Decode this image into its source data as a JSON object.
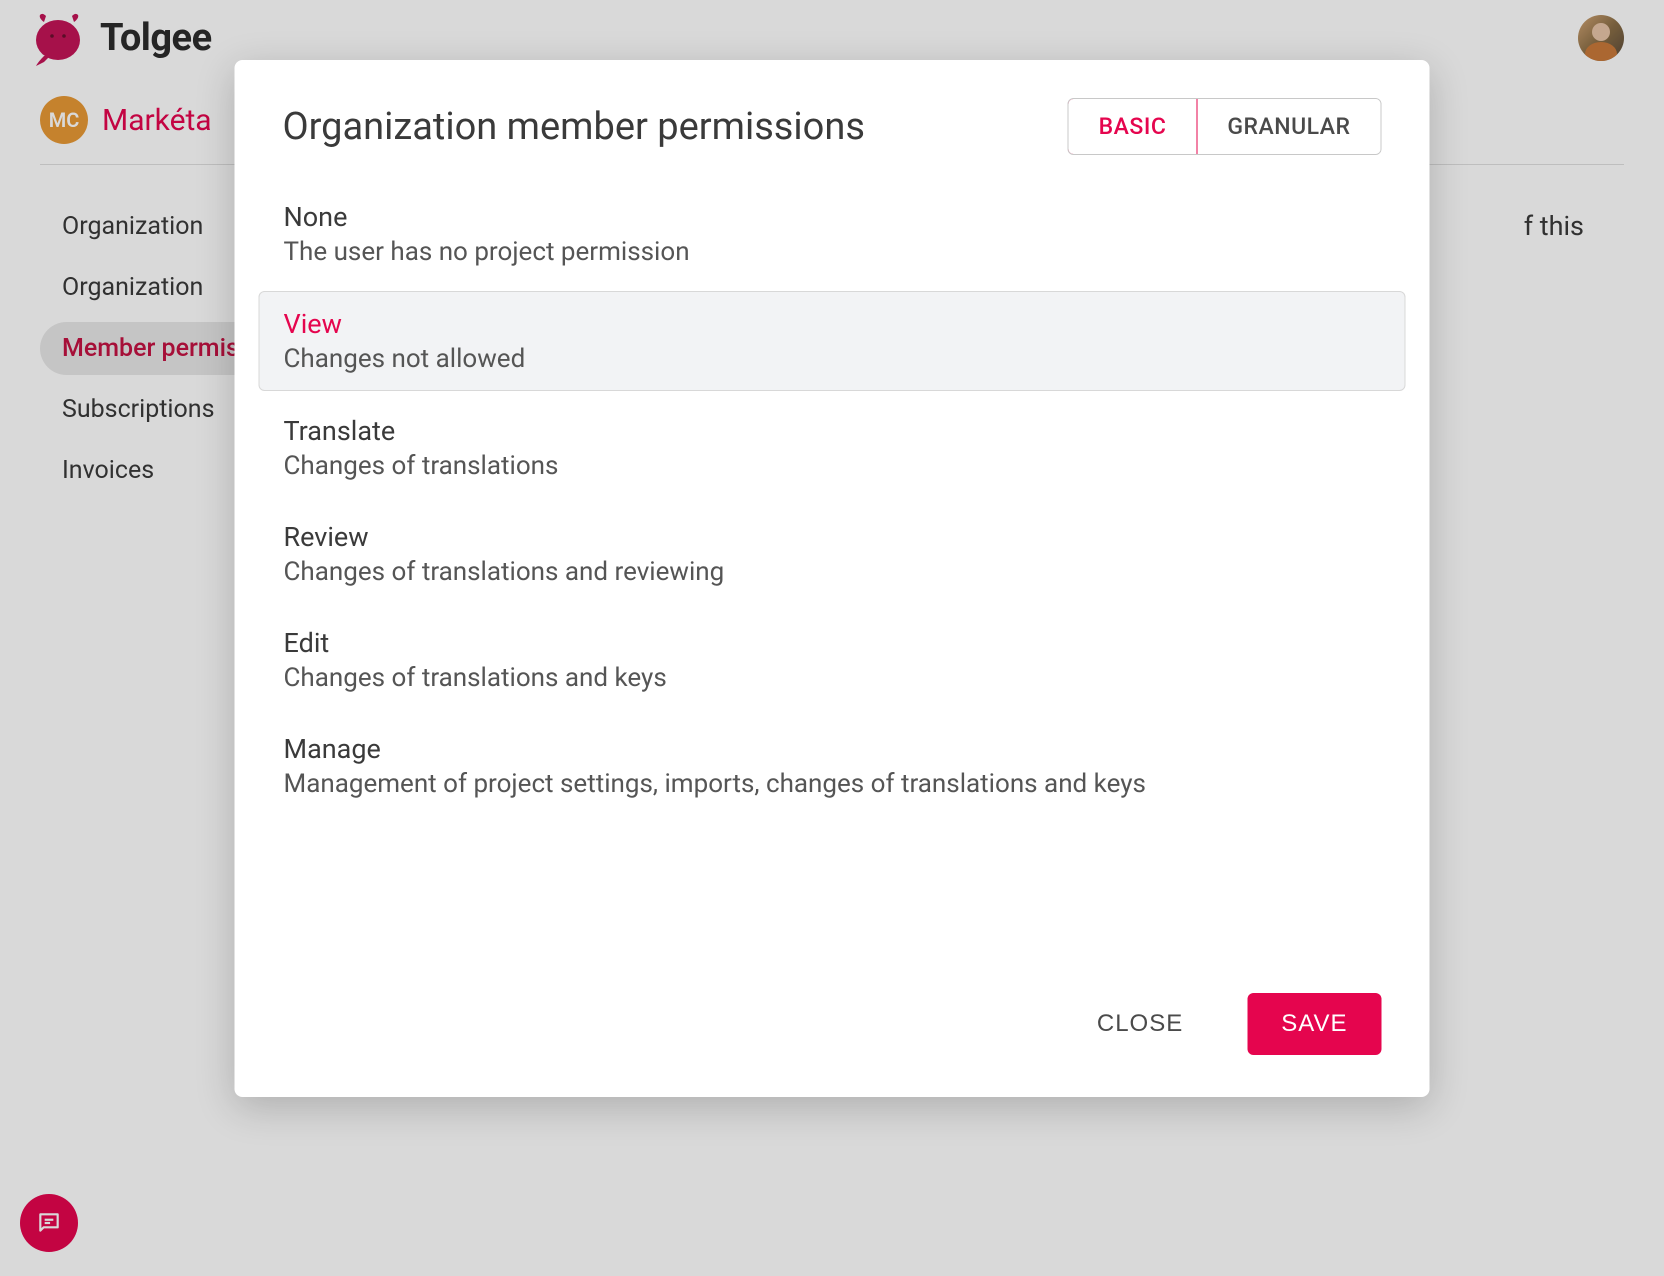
{
  "brand": {
    "name": "Tolgee"
  },
  "org": {
    "badge": "MC",
    "name": "Markéta"
  },
  "sidebar": {
    "items": [
      {
        "label": "Organization",
        "active": false
      },
      {
        "label": "Organization",
        "active": false
      },
      {
        "label": "Member permissions",
        "active": true
      },
      {
        "label": "Subscriptions",
        "active": false
      },
      {
        "label": "Invoices",
        "active": false
      }
    ]
  },
  "mainText": "f this",
  "dialog": {
    "title": "Organization member permissions",
    "tabs": {
      "basic": "BASIC",
      "granular": "GRANULAR"
    },
    "selected": 1,
    "options": [
      {
        "title": "None",
        "desc": "The user has no project permission"
      },
      {
        "title": "View",
        "desc": "Changes not allowed"
      },
      {
        "title": "Translate",
        "desc": "Changes of translations"
      },
      {
        "title": "Review",
        "desc": "Changes of translations and reviewing"
      },
      {
        "title": "Edit",
        "desc": "Changes of translations and keys"
      },
      {
        "title": "Manage",
        "desc": "Management of project settings, imports, changes of translations and keys"
      }
    ],
    "buttons": {
      "close": "CLOSE",
      "save": "SAVE"
    }
  }
}
